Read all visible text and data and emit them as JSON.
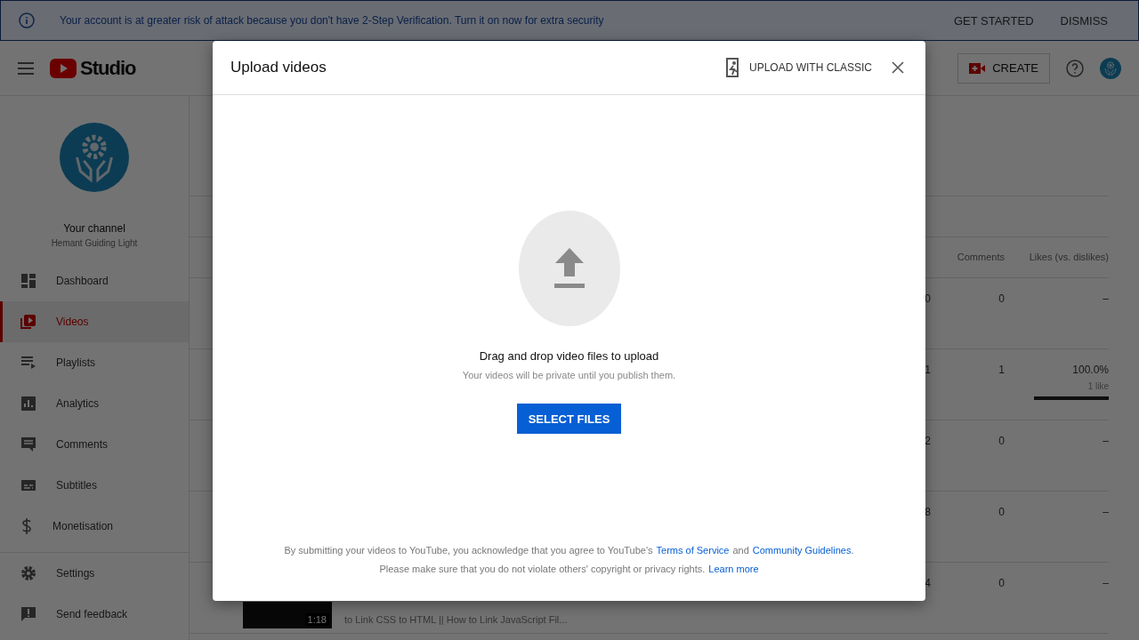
{
  "banner": {
    "message": "Your account is at greater risk of attack because you don't have 2-Step Verification. Turn it on now for extra security",
    "actions": [
      "GET STARTED",
      "DISMISS"
    ]
  },
  "header": {
    "logo": "Studio",
    "create": "CREATE"
  },
  "channel": {
    "title": "Your channel",
    "name": "Hemant Guiding Light"
  },
  "sidebar": {
    "items": [
      {
        "kind": "dashboard",
        "label": "Dashboard",
        "selected": false
      },
      {
        "kind": "videos",
        "label": "Videos",
        "selected": true
      },
      {
        "kind": "playlists",
        "label": "Playlists",
        "selected": false
      },
      {
        "kind": "analytics",
        "label": "Analytics",
        "selected": false
      },
      {
        "kind": "comments",
        "label": "Comments",
        "selected": false
      },
      {
        "kind": "subtitles",
        "label": "Subtitles",
        "selected": false
      },
      {
        "kind": "monetisation",
        "label": "Monetisation",
        "selected": false
      }
    ],
    "footer": [
      {
        "kind": "settings",
        "label": "Settings"
      },
      {
        "kind": "feedback",
        "label": "Send feedback"
      }
    ]
  },
  "table": {
    "columns": [
      "Comments",
      "Likes (vs. dislikes)"
    ],
    "rows": [
      {
        "views": "0",
        "comments": "0",
        "likes": "–"
      },
      {
        "views": "1",
        "comments": "1",
        "likes": "100.0%",
        "like_count": "1 like",
        "level": 1
      },
      {
        "views": "2",
        "comments": "0",
        "likes": "–"
      },
      {
        "views": "8",
        "comments": "0",
        "likes": "–"
      },
      {
        "views": "4",
        "comments": "0",
        "likes": "–",
        "duration": "1:18",
        "description": "to Link CSS to HTML || How to Link JavaScript Fil..."
      }
    ]
  },
  "dialog": {
    "title": "Upload videos",
    "classic": "UPLOAD WITH CLASSIC",
    "prompt": "Drag and drop video files to upload",
    "hint": "Your videos will be private until you publish them.",
    "button": "SELECT FILES",
    "legal_1": "By submitting your videos to YouTube, you acknowledge that you agree to YouTube's",
    "terms": "Terms of Service",
    "and": "and",
    "guidelines": "Community Guidelines",
    "dot": ".",
    "legal_2": "Please make sure that you do not violate others' copyright or privacy rights.",
    "learn": "Learn more"
  }
}
